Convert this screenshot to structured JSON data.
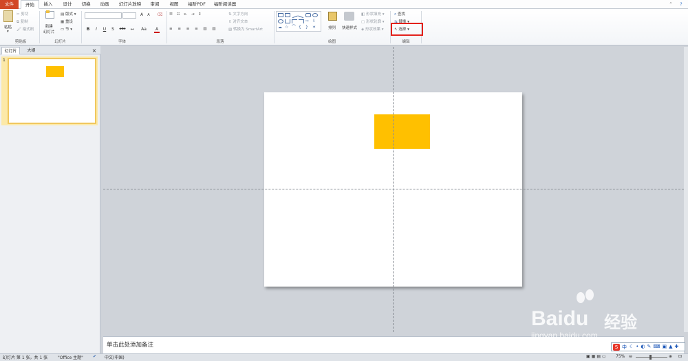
{
  "tabs": {
    "file": "文件",
    "items": [
      "开始",
      "插入",
      "设计",
      "切换",
      "动画",
      "幻灯片放映",
      "审阅",
      "视图",
      "福昕PDF",
      "福昕阅读器"
    ]
  },
  "clipboard": {
    "paste": "粘贴",
    "cut": "剪切",
    "copy": "复制",
    "format_painter": "格式刷",
    "label": "剪贴板"
  },
  "slides_group": {
    "new_slide": "新建\n幻灯片",
    "layout": "版式",
    "reset": "重设",
    "section": "节",
    "label": "幻灯片"
  },
  "font_group": {
    "label": "字体",
    "bold": "B",
    "italic": "I",
    "underline": "U",
    "strike": "S",
    "shadow": "abc",
    "grow": "A",
    "shrink": "A",
    "change_case": "Aa",
    "font_color": "A"
  },
  "paragraph_group": {
    "label": "段落",
    "text_direction": "文字方向",
    "align_text": "对齐文本",
    "smartart": "转换为 SmartArt"
  },
  "drawing_group": {
    "label": "绘图",
    "arrange": "排列",
    "quick_styles": "快速样式",
    "shape_fill": "形状填充",
    "shape_outline": "形状轮廓",
    "shape_effects": "形状效果"
  },
  "editing_group": {
    "label": "编辑",
    "find": "查找",
    "replace": "替换",
    "select": "选择"
  },
  "pane_tabs": {
    "slides": "幻灯片",
    "outline": "大纲"
  },
  "thumbnail_number": "1",
  "notes_placeholder": "单击此处添加备注",
  "status": {
    "slide_info": "幻灯片 第 1 张，共 1 张",
    "theme": "\"Office 主题\"",
    "language": "中文(中国)",
    "zoom": "75%"
  },
  "watermark": {
    "brand": "Baidu",
    "cn": "经验",
    "url": "jingyan.baidu.com"
  },
  "ime": {
    "mode": "中"
  },
  "colors": {
    "accent": "#ffc000",
    "file_tab": "#d24726",
    "highlight": "#e3211b"
  }
}
